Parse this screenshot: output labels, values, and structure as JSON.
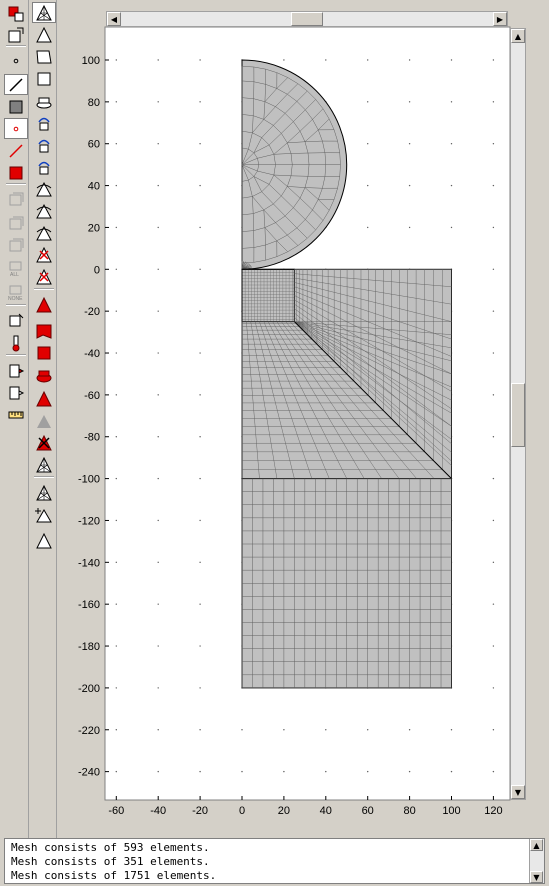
{
  "plot": {
    "x_ticks": [
      "-60",
      "-40",
      "-20",
      "0",
      "20",
      "40",
      "60",
      "80",
      "100",
      "120"
    ],
    "y_ticks": [
      "100",
      "80",
      "60",
      "40",
      "20",
      "0",
      "-20",
      "-40",
      "-60",
      "-80",
      "-100",
      "-120",
      "-140",
      "-160",
      "-180",
      "-200",
      "-220",
      "-240"
    ]
  },
  "console": {
    "lines": [
      "Mesh consists of 593 elements.",
      "Mesh consists of 351 elements.",
      "Mesh consists of 1751 elements."
    ]
  },
  "toolbar_left": {
    "icons": [
      "draw-mode-icon",
      "subdomain-mode-icon",
      "point-mode-icon",
      "boundary-mode-icon",
      "subdomain-select-icon",
      "point-red-icon",
      "line-red-icon",
      "square-red-icon",
      "geom1-icon",
      "geom2-icon",
      "geom3-icon",
      "select-all-icon",
      "select-none-icon",
      "mesh-export-icon",
      "thermometer-icon",
      "copy-icon",
      "paste-icon",
      "measure-icon"
    ]
  },
  "toolbar_right": {
    "icons": [
      "initialize-mesh-icon",
      "triangle-icon",
      "polygon-icon",
      "square-icon",
      "extrude-icon",
      "refine-mesh-icon",
      "refine-selected-icon",
      "swept-mesh-icon",
      "revolve-mesh-icon",
      "extrude-mesh-icon",
      "sweep-icon",
      "delete-mesh-icon",
      "delete-element-icon",
      "red-triangle-icon",
      "red-shape-icon",
      "red-square-icon",
      "red-extrude-icon",
      "red-refine-icon",
      "grey-mesh-icon",
      "red-delete-icon",
      "mesh-stats-icon",
      "mesh-select-icon",
      "add-vertex-icon",
      "triangle-outline-icon"
    ]
  }
}
